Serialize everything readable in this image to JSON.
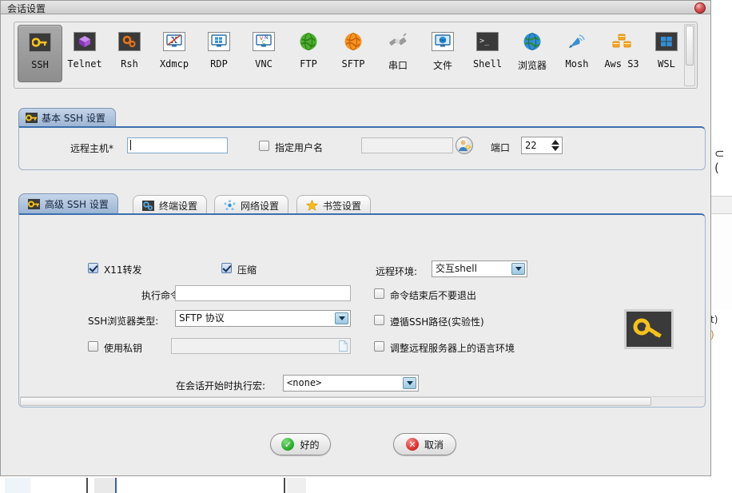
{
  "window": {
    "title": "会话设置",
    "close_icon": "close-circle-icon"
  },
  "protocol_toolbar": {
    "selected": "SSH",
    "items": [
      {
        "label": "SSH",
        "icon": "key-icon",
        "selected": true
      },
      {
        "label": "Telnet",
        "icon": "cube-icon",
        "selected": false
      },
      {
        "label": "Rsh",
        "icon": "gears-icon",
        "selected": false
      },
      {
        "label": "Xdmcp",
        "icon": "x-monitor-icon",
        "selected": false
      },
      {
        "label": "RDP",
        "icon": "windows-monitor-icon",
        "selected": false
      },
      {
        "label": "VNC",
        "icon": "vnc-monitor-icon",
        "selected": false
      },
      {
        "label": "FTP",
        "icon": "green-globe-icon",
        "selected": false
      },
      {
        "label": "SFTP",
        "icon": "orange-globe-icon",
        "selected": false
      },
      {
        "label": "串口",
        "icon": "plug-icon",
        "selected": false
      },
      {
        "label": "文件",
        "icon": "globe-monitor-icon",
        "selected": false
      },
      {
        "label": "Shell",
        "icon": "terminal-icon",
        "selected": false
      },
      {
        "label": "浏览器",
        "icon": "blue-globe-icon",
        "selected": false
      },
      {
        "label": "Mosh",
        "icon": "satellite-icon",
        "selected": false
      },
      {
        "label": "Aws S3",
        "icon": "aws-cubes-icon",
        "selected": false
      },
      {
        "label": "WSL",
        "icon": "windows-icon",
        "selected": false
      }
    ],
    "scrollbar": "toolbar-vertical-scrollbar"
  },
  "basic_ssh": {
    "tab_label": "基本 SSH 设置",
    "tab_icon": "key-icon",
    "host_label": "远程主机*",
    "host_value": "",
    "host_placeholder": "",
    "specify_user_label": "指定用户名",
    "specify_user_checked": false,
    "username_value": "",
    "user_button_icon": "user-key-icon",
    "port_label": "端口",
    "port_value": "22"
  },
  "advanced": {
    "tabs": [
      {
        "label": "高级 SSH 设置",
        "icon": "key-icon",
        "active": true
      },
      {
        "label": "终端设置",
        "icon": "gears-icon",
        "active": false
      },
      {
        "label": "网络设置",
        "icon": "network-icon",
        "active": false
      },
      {
        "label": "书签设置",
        "icon": "star-icon",
        "active": false
      }
    ],
    "x11_label": "X11转发",
    "x11_checked": true,
    "compression_label": "压缩",
    "compression_checked": true,
    "exec_cmd_label": "执行命令:",
    "exec_cmd_value": "",
    "browser_type_label": "SSH浏览器类型:",
    "browser_type_value": "SFTP 协议",
    "use_privkey_label": "使用私钥",
    "use_privkey_checked": false,
    "privkey_value": "",
    "privkey_file_icon": "file-icon",
    "remote_env_label": "远程环境:",
    "remote_env_value": "交互shell",
    "no_exit_label": "命令结束后不要退出",
    "no_exit_checked": false,
    "follow_ssh_path_label": "遵循SSH路径(实验性)",
    "follow_ssh_path_checked": false,
    "adjust_locale_label": "调整远程服务器上的语言环境",
    "adjust_locale_checked": false,
    "macro_label": "在会话开始时执行宏:",
    "macro_value": "<none>",
    "key_preview_icon": "key-icon"
  },
  "footer": {
    "ok_label": "好的",
    "ok_icon": "check-circle-icon",
    "cancel_label": "取消",
    "cancel_icon": "x-circle-icon"
  },
  "background": {
    "fragment_1": "t)",
    "fragment_2": ")"
  },
  "colors": {
    "dialog_bg": "#ececec",
    "tab_active": "#9db6d4",
    "tab_border": "#3c6fae",
    "field_border": "#7fa8c9",
    "title_bar": "#d9d9d9",
    "accent_blue": "#3c6fae"
  }
}
